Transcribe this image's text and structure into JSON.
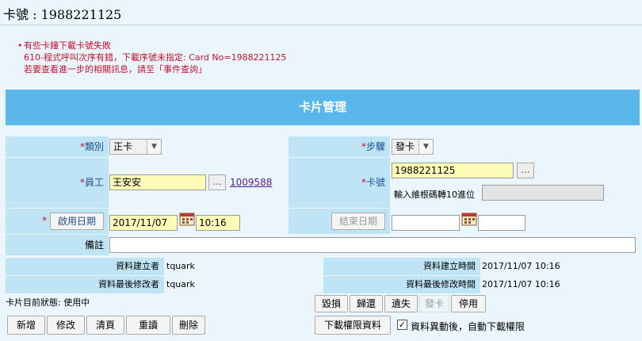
{
  "header": {
    "card_label": "卡號 : 1988221125"
  },
  "errors": {
    "bullet": "•",
    "line1": "有些卡鐘下載卡號失敗",
    "line2": "610-程式呼叫次序有錯，下載序號未指定: Card No=1988221125",
    "line3": "若要查看進一步的相關訊息，請至「事件查詢」"
  },
  "banner": {
    "title": "卡片管理"
  },
  "form": {
    "type": {
      "req": "*",
      "label": "類別",
      "value": "正卡"
    },
    "step": {
      "req": "*",
      "label": "步驟",
      "value": "發卡"
    },
    "employee": {
      "req": "*",
      "label": "員工",
      "value": "王安安",
      "browse": "...",
      "link": "1009588"
    },
    "card_no": {
      "req": "*",
      "label": "卡號",
      "value": "1988221125",
      "browse": "...",
      "reverse_label": "輸入維根碼轉10進位",
      "reverse_value": ""
    },
    "start": {
      "req": "*",
      "button": "啟用日期",
      "date": "2017/11/07",
      "time": "10:16"
    },
    "end": {
      "button": "結束日期",
      "date": "",
      "time": ""
    },
    "remark": {
      "label": "備註",
      "value": ""
    }
  },
  "info": {
    "created_by_label": "資料建立者",
    "created_by": "tquark",
    "created_time_label": "資料建立時間",
    "created_time": "2017/11/07 10:16",
    "modified_by_label": "資料最後修改者",
    "modified_by": "tquark",
    "modified_time_label": "資料最後修改時間",
    "modified_time": "2017/11/07 10:16"
  },
  "status": {
    "text": "卡片目前狀態: 使用中",
    "buttons": [
      "毀損",
      "歸還",
      "遺失",
      "發卡",
      "停用"
    ]
  },
  "toolbar": {
    "buttons": [
      "新增",
      "修改",
      "清頁",
      "重讀",
      "刪除"
    ],
    "download": "下載權限資料",
    "auto_check": "✓",
    "auto_label": "資料異動後，自動下載權限"
  },
  "colors": {
    "banner": "#5ab7ec",
    "label_bg": "#bfe4f6",
    "error": "#c8102e",
    "required_field": "#fffcb8"
  }
}
